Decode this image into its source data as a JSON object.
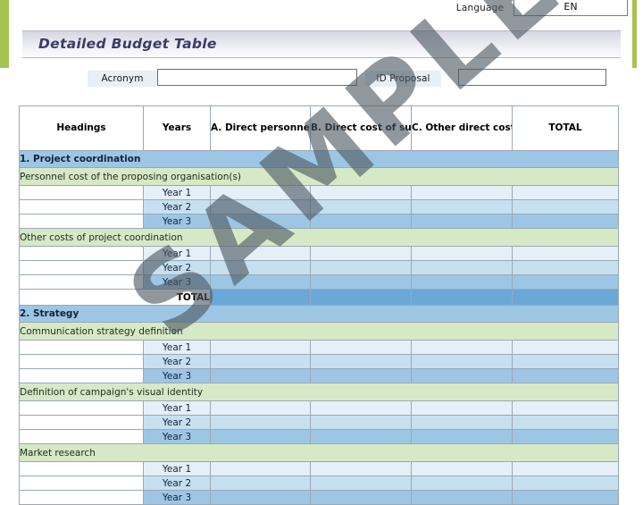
{
  "theme": {
    "accent_green": "#a6c352",
    "title_text_color": "#3b3b68",
    "section_blue": "#9dc6e4",
    "sub_green": "#d6e9c6",
    "year1_blue": "#e5eff7",
    "year2_blue": "#c6e0f0",
    "year3_blue": "#9dc6e4",
    "total_blue": "#6aa8d8"
  },
  "topbar": {
    "language_label": "Language",
    "language_value": "EN"
  },
  "header": {
    "title": "Detailed Budget Table"
  },
  "meta": {
    "acronym_label": "Acronym",
    "acronym_value": "",
    "acronym_placeholder": "",
    "id_proposal_label": "ID Proposal",
    "id_proposal_value": "",
    "id_proposal_placeholder": ""
  },
  "table": {
    "columns": [
      "Headings",
      "Years",
      "A. Direct personnel costs",
      "B. Direct cost of subcontracting",
      "C. Other direct costs",
      "TOTAL"
    ],
    "year_labels": [
      "Year 1",
      "Year 2",
      "Year 3"
    ],
    "total_label": "TOTAL",
    "sections": [
      {
        "title": "1. Project coordination",
        "subsections": [
          {
            "title": "Personnel cost of the proposing organisation(s)"
          },
          {
            "title": "Other costs of project coordination"
          }
        ],
        "has_total": true
      },
      {
        "title": "2. Strategy",
        "subsections": [
          {
            "title": "Communication strategy definition"
          },
          {
            "title": "Definition of campaign's visual identity"
          },
          {
            "title": "Market research"
          }
        ],
        "has_total": false
      }
    ]
  },
  "watermark": {
    "text": "SAMPLE"
  }
}
